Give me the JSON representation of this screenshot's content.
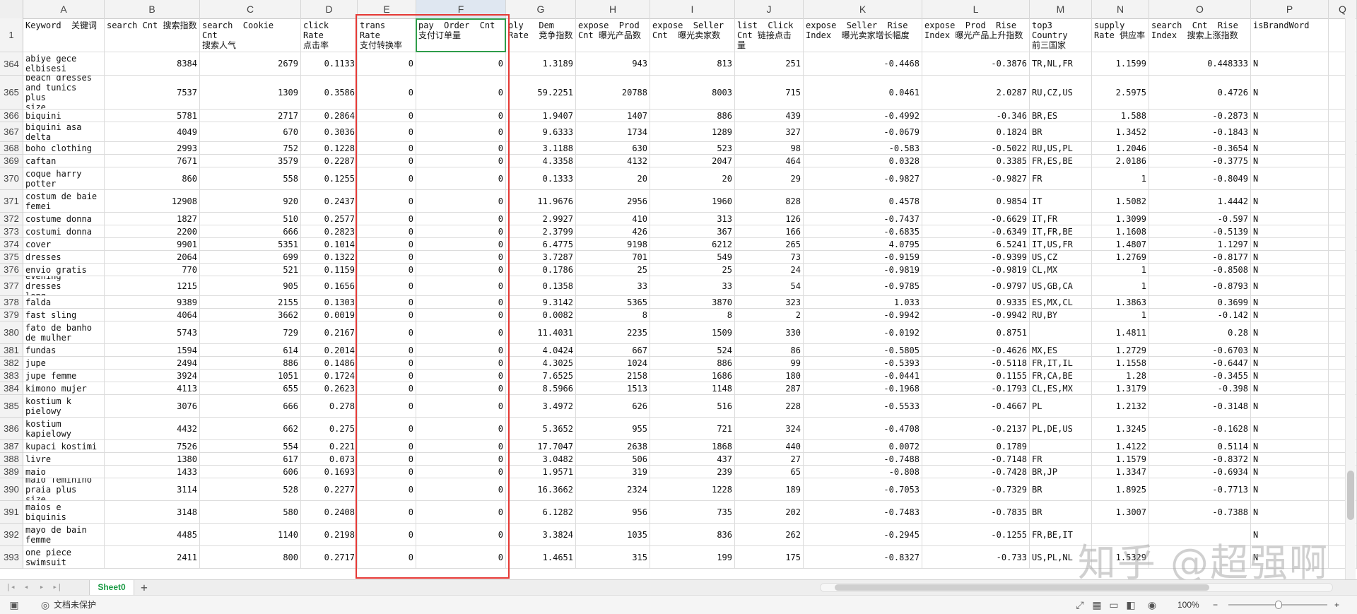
{
  "columns": [
    "A",
    "B",
    "C",
    "D",
    "E",
    "F",
    "G",
    "H",
    "I",
    "J",
    "K",
    "L",
    "M",
    "N",
    "O",
    "P",
    "Q"
  ],
  "selected_column": "F",
  "header_row": {
    "row_number": "1",
    "cells": [
      "Keyword  关键词",
      "search Cnt 搜索指数",
      "search  Cookie  Cnt\n搜索人气",
      "click  Rate\n点击率",
      "trans  Rate\n支付转换率",
      "pay  Order  Cnt\n支付订单量",
      "ply   Dem\nRate  竞争指数",
      "expose  Prod\nCnt 曝光产品数",
      "expose  Seller\nCnt  曝光卖家数",
      "list  Click\nCnt 链接点击\n量",
      "expose  Seller  Rise\nIndex  曝光卖家增长幅度",
      "expose  Prod  Rise\nIndex 曝光产品上升指数",
      "top3 Country\n前三国家",
      "supply\nRate 供应率",
      "search  Cnt  Rise\nIndex  搜索上涨指数",
      "isBrandWord",
      ""
    ]
  },
  "rows": [
    {
      "n": "364",
      "cells": [
        "abiye gece\nelbisesi",
        "8384",
        "2679",
        "0.1133",
        "0",
        "0",
        "1.3189",
        "943",
        "813",
        "251",
        "-0.4468",
        "-0.3876",
        "TR,NL,FR",
        "1.1599",
        "0.448333",
        "N"
      ]
    },
    {
      "n": "365",
      "cells": [
        "beach dresses\nand tunics plus\nsize",
        "7537",
        "1309",
        "0.3586",
        "0",
        "0",
        "59.2251",
        "20788",
        "8003",
        "715",
        "0.0461",
        "2.0287",
        "RU,CZ,US",
        "2.5975",
        "0.4726",
        "N"
      ]
    },
    {
      "n": "366",
      "cells": [
        "biquini",
        "5781",
        "2717",
        "0.2864",
        "0",
        "0",
        "1.9407",
        "1407",
        "886",
        "439",
        "-0.4992",
        "-0.346",
        "BR,ES",
        "1.588",
        "-0.2873",
        "N"
      ]
    },
    {
      "n": "367",
      "cells": [
        "biquini asa\ndelta",
        "4049",
        "670",
        "0.3036",
        "0",
        "0",
        "9.6333",
        "1734",
        "1289",
        "327",
        "-0.0679",
        "0.1824",
        "BR",
        "1.3452",
        "-0.1843",
        "N"
      ]
    },
    {
      "n": "368",
      "cells": [
        "boho clothing",
        "2993",
        "752",
        "0.1228",
        "0",
        "0",
        "3.1188",
        "630",
        "523",
        "98",
        "-0.583",
        "-0.5022",
        "RU,US,PL",
        "1.2046",
        "-0.3654",
        "N"
      ]
    },
    {
      "n": "369",
      "cells": [
        "caftan",
        "7671",
        "3579",
        "0.2287",
        "0",
        "0",
        "4.3358",
        "4132",
        "2047",
        "464",
        "0.0328",
        "0.3385",
        "FR,ES,BE",
        "2.0186",
        "-0.3775",
        "N"
      ]
    },
    {
      "n": "370",
      "cells": [
        "coque harry\npotter",
        "860",
        "558",
        "0.1255",
        "0",
        "0",
        "0.1333",
        "20",
        "20",
        "29",
        "-0.9827",
        "-0.9827",
        "FR",
        "1",
        "-0.8049",
        "N"
      ]
    },
    {
      "n": "371",
      "cells": [
        "costum de baie\nfemei",
        "12908",
        "920",
        "0.2437",
        "0",
        "0",
        "11.9676",
        "2956",
        "1960",
        "828",
        "0.4578",
        "0.9854",
        "IT",
        "1.5082",
        "1.4442",
        "N"
      ]
    },
    {
      "n": "372",
      "cells": [
        "costume donna",
        "1827",
        "510",
        "0.2577",
        "0",
        "0",
        "2.9927",
        "410",
        "313",
        "126",
        "-0.7437",
        "-0.6629",
        "IT,FR",
        "1.3099",
        "-0.597",
        "N"
      ]
    },
    {
      "n": "373",
      "cells": [
        "costumi donna",
        "2200",
        "666",
        "0.2823",
        "0",
        "0",
        "2.3799",
        "426",
        "367",
        "166",
        "-0.6835",
        "-0.6349",
        "IT,FR,BE",
        "1.1608",
        "-0.5139",
        "N"
      ]
    },
    {
      "n": "374",
      "cells": [
        "cover",
        "9901",
        "5351",
        "0.1014",
        "0",
        "0",
        "6.4775",
        "9198",
        "6212",
        "265",
        "4.0795",
        "6.5241",
        "IT,US,FR",
        "1.4807",
        "1.1297",
        "N"
      ]
    },
    {
      "n": "375",
      "cells": [
        "dresses",
        "2064",
        "699",
        "0.1322",
        "0",
        "0",
        "3.7287",
        "701",
        "549",
        "73",
        "-0.9159",
        "-0.9399",
        "US,CZ",
        "1.2769",
        "-0.8177",
        "N"
      ]
    },
    {
      "n": "376",
      "cells": [
        "envio gratis",
        "770",
        "521",
        "0.1159",
        "0",
        "0",
        "0.1786",
        "25",
        "25",
        "24",
        "-0.9819",
        "-0.9819",
        "CL,MX",
        "1",
        "-0.8508",
        "N"
      ]
    },
    {
      "n": "377",
      "cells": [
        "evening dresses\nlong",
        "1215",
        "905",
        "0.1656",
        "0",
        "0",
        "0.1358",
        "33",
        "33",
        "54",
        "-0.9785",
        "-0.9797",
        "US,GB,CA",
        "1",
        "-0.8793",
        "N"
      ]
    },
    {
      "n": "378",
      "cells": [
        "falda",
        "9389",
        "2155",
        "0.1303",
        "0",
        "0",
        "9.3142",
        "5365",
        "3870",
        "323",
        "1.033",
        "0.9335",
        "ES,MX,CL",
        "1.3863",
        "0.3699",
        "N"
      ]
    },
    {
      "n": "379",
      "cells": [
        "fast sling",
        "4064",
        "3662",
        "0.0019",
        "0",
        "0",
        "0.0082",
        "8",
        "8",
        "2",
        "-0.9942",
        "-0.9942",
        "RU,BY",
        "1",
        "-0.142",
        "N"
      ]
    },
    {
      "n": "380",
      "cells": [
        "fato de banho\nde mulher",
        "5743",
        "729",
        "0.2167",
        "0",
        "0",
        "11.4031",
        "2235",
        "1509",
        "330",
        "-0.0192",
        "0.8751",
        "",
        "1.4811",
        "0.28",
        "N"
      ]
    },
    {
      "n": "381",
      "cells": [
        "fundas",
        "1594",
        "614",
        "0.2014",
        "0",
        "0",
        "4.0424",
        "667",
        "524",
        "86",
        "-0.5805",
        "-0.4626",
        "MX,ES",
        "1.2729",
        "-0.6703",
        "N"
      ]
    },
    {
      "n": "382",
      "cells": [
        "jupe",
        "2494",
        "886",
        "0.1486",
        "0",
        "0",
        "4.3025",
        "1024",
        "886",
        "99",
        "-0.5393",
        "-0.5118",
        "FR,IT,IL",
        "1.1558",
        "-0.6447",
        "N"
      ]
    },
    {
      "n": "383",
      "cells": [
        "jupe femme",
        "3924",
        "1051",
        "0.1724",
        "0",
        "0",
        "7.6525",
        "2158",
        "1686",
        "180",
        "-0.0441",
        "0.1155",
        "FR,CA,BE",
        "1.28",
        "-0.3455",
        "N"
      ]
    },
    {
      "n": "384",
      "cells": [
        "kimono mujer",
        "4113",
        "655",
        "0.2623",
        "0",
        "0",
        "8.5966",
        "1513",
        "1148",
        "287",
        "-0.1968",
        "-0.1793",
        "CL,ES,MX",
        "1.3179",
        "-0.398",
        "N"
      ]
    },
    {
      "n": "385",
      "cells": [
        "kostium k\npielowy",
        "3076",
        "666",
        "0.278",
        "0",
        "0",
        "3.4972",
        "626",
        "516",
        "228",
        "-0.5533",
        "-0.4667",
        "PL",
        "1.2132",
        "-0.3148",
        "N"
      ]
    },
    {
      "n": "386",
      "cells": [
        "kostium\nkapielowy",
        "4432",
        "662",
        "0.275",
        "0",
        "0",
        "5.3652",
        "955",
        "721",
        "324",
        "-0.4708",
        "-0.2137",
        "PL,DE,US",
        "1.3245",
        "-0.1628",
        "N"
      ]
    },
    {
      "n": "387",
      "cells": [
        "kupaci kostimi",
        "7526",
        "554",
        "0.221",
        "0",
        "0",
        "17.7047",
        "2638",
        "1868",
        "440",
        "0.0072",
        "0.1789",
        "",
        "1.4122",
        "0.5114",
        "N"
      ]
    },
    {
      "n": "388",
      "cells": [
        "livre",
        "1380",
        "617",
        "0.073",
        "0",
        "0",
        "3.0482",
        "506",
        "437",
        "27",
        "-0.7488",
        "-0.7148",
        "FR",
        "1.1579",
        "-0.8372",
        "N"
      ]
    },
    {
      "n": "389",
      "cells": [
        "maio",
        "1433",
        "606",
        "0.1693",
        "0",
        "0",
        "1.9571",
        "319",
        "239",
        "65",
        "-0.808",
        "-0.7428",
        "BR,JP",
        "1.3347",
        "-0.6934",
        "N"
      ]
    },
    {
      "n": "390",
      "cells": [
        "maio feminino\npraia plus size",
        "3114",
        "528",
        "0.2277",
        "0",
        "0",
        "16.3662",
        "2324",
        "1228",
        "189",
        "-0.7053",
        "-0.7329",
        "BR",
        "1.8925",
        "-0.7713",
        "N"
      ]
    },
    {
      "n": "391",
      "cells": [
        "maios e\nbiquinis",
        "3148",
        "580",
        "0.2408",
        "0",
        "0",
        "6.1282",
        "956",
        "735",
        "202",
        "-0.7483",
        "-0.7835",
        "BR",
        "1.3007",
        "-0.7388",
        "N"
      ]
    },
    {
      "n": "392",
      "cells": [
        "mayo de bain\nfemme",
        "4485",
        "1140",
        "0.2198",
        "0",
        "0",
        "3.3824",
        "1035",
        "836",
        "262",
        "-0.2945",
        "-0.1255",
        "FR,BE,IT",
        "",
        "",
        "N"
      ]
    },
    {
      "n": "393",
      "cells": [
        "one piece\nswimsuit",
        "2411",
        "800",
        "0.2717",
        "0",
        "0",
        "1.4651",
        "315",
        "199",
        "175",
        "-0.8327",
        "-0.733",
        "US,PL,NL",
        "1.5329",
        "",
        "N"
      ]
    }
  ],
  "sheet_tab": "Sheet0",
  "add_sheet": "+",
  "status": {
    "protect_text": "文档未保护",
    "zoom": "100%",
    "zoom_minus": "−",
    "zoom_plus": "+"
  },
  "watermark": "知乎 @超强啊",
  "highlight_colors": {
    "red": "#e53935",
    "green": "#2f9d4a"
  }
}
